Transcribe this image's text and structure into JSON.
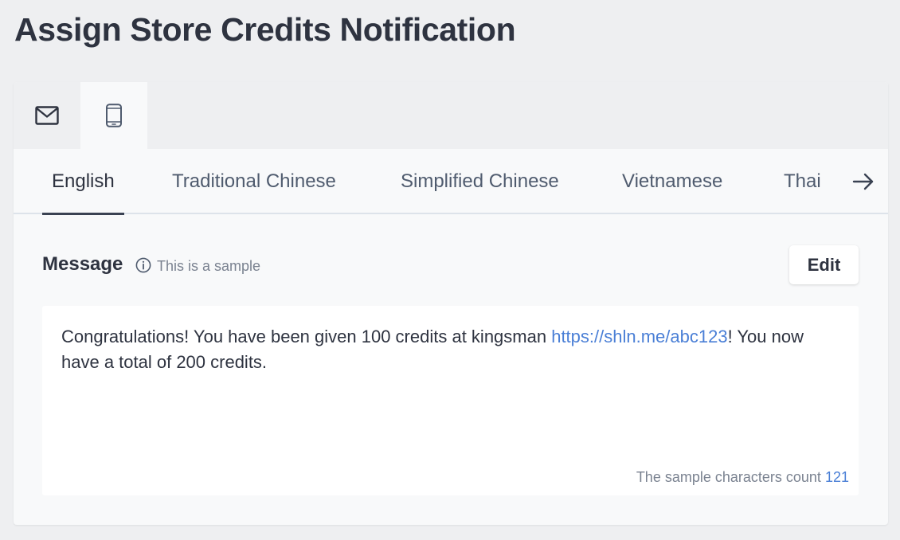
{
  "page": {
    "title": "Assign Store Credits Notification"
  },
  "channels": {
    "items": [
      {
        "icon": "envelope-icon",
        "active": false
      },
      {
        "icon": "mobile-phone-icon",
        "active": true
      }
    ]
  },
  "languages": {
    "tabs": [
      {
        "label": "English",
        "active": true
      },
      {
        "label": "Traditional Chinese",
        "active": false
      },
      {
        "label": "Simplified Chinese",
        "active": false
      },
      {
        "label": "Vietnamese",
        "active": false
      },
      {
        "label": "Thai",
        "active": false
      }
    ],
    "more_icon": "arrow-right-icon"
  },
  "message": {
    "label": "Message",
    "info_icon": "info-icon",
    "sample_note": "This is a sample",
    "edit_label": "Edit",
    "text_before_link": "Congratulations! You have been given 100 credits at kingsman ",
    "link": "https://shln.me/abc123",
    "text_after_link": "! You now have a total of 200 credits.",
    "char_count_label": "The sample characters count",
    "char_count_value": "121"
  },
  "colors": {
    "link": "#4a7fd6",
    "text": "#2e3340",
    "background": "#eeeff1"
  }
}
